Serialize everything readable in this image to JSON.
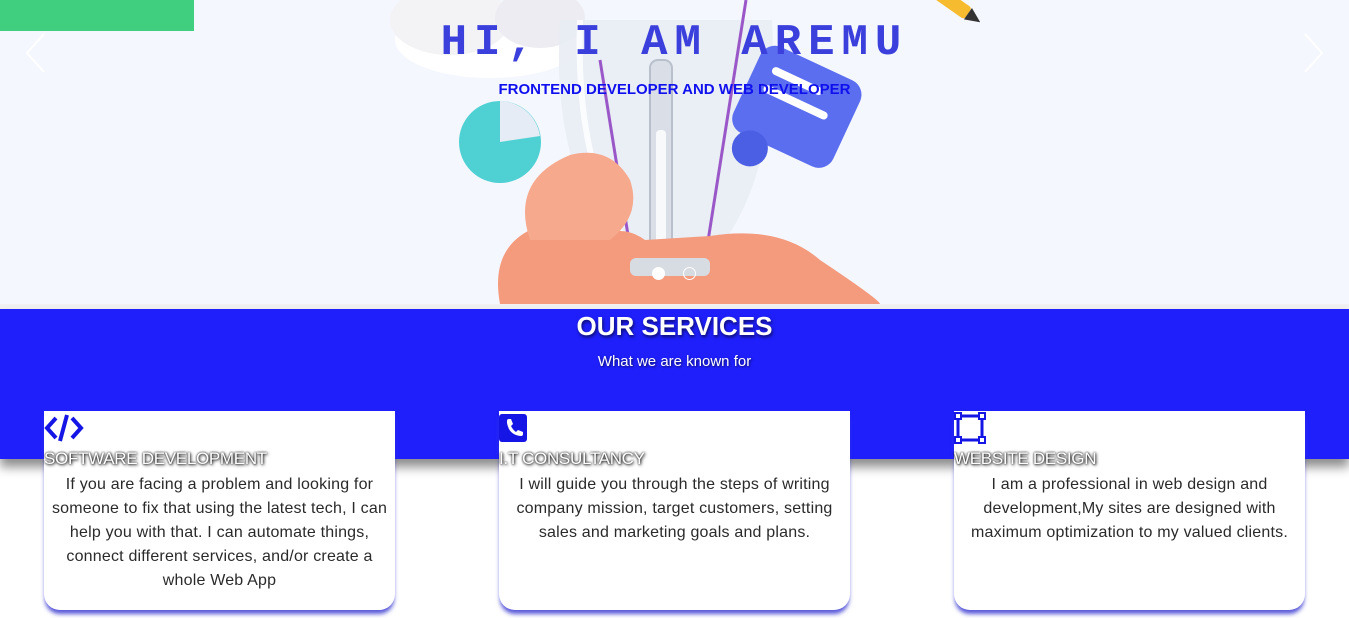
{
  "hero": {
    "title": "HI, I AM AREMU",
    "subtitle": "FRONTEND DEVELOPER AND WEB DEVELOPER",
    "slide_count": 2,
    "active_slide": 1
  },
  "services": {
    "title": "OUR SERVICES",
    "subtitle": "What we are known for",
    "cards": [
      {
        "icon": "code-icon",
        "title": "SOFTWARE DEVELOPMENT",
        "description": "If you are facing a problem and looking for someone to fix that using the latest tech, I can help you with that. I can automate things, connect different services, and/or create a whole Web App"
      },
      {
        "icon": "phone-icon",
        "title": "I.T CONSULTANCY",
        "description": "I will guide you through the steps of writing company mission, target customers, setting sales and marketing goals and plans."
      },
      {
        "icon": "vector-square-icon",
        "title": "WEBSITE DESIGN",
        "description": "I am a professional in web design and development,My sites are designed with maximum optimization to my valued clients."
      }
    ]
  },
  "colors": {
    "accent_blue": "#1f1ffb",
    "title_blue": "#3b3fdc",
    "green_tab": "#3fcf7e"
  }
}
